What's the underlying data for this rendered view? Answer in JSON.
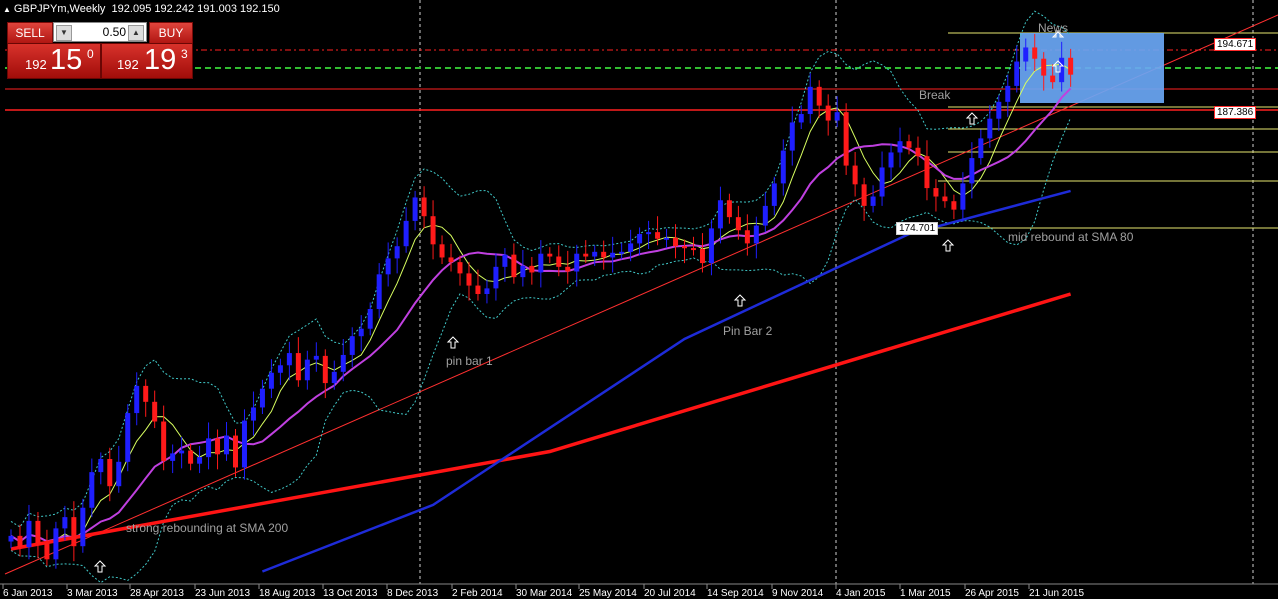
{
  "header": {
    "symbol_tf": "GBPJPYm,Weekly",
    "ohlc": "192.095 192.242 191.003 192.150"
  },
  "trade_panel": {
    "sell_label": "SELL",
    "buy_label": "BUY",
    "lot_value": "0.50",
    "sell_small": "192",
    "sell_big": "15",
    "sell_sup": "0",
    "buy_small": "192",
    "buy_big": "19",
    "buy_sup": "3"
  },
  "annotations": {
    "news": "News",
    "break": "Break",
    "pin_bar_1": "pin bar 1",
    "pin_bar_2": "Pin Bar 2",
    "strong_rebound": "strong rebounding at SMA 200",
    "mid_rebound": "mid rebound at SMA 80"
  },
  "price_labels": {
    "top": "194.671",
    "mid": "187.386",
    "low": "174.701"
  },
  "colors": {
    "background": "#000000",
    "bull_candle": "#1f1fff",
    "bear_candle": "#ff1a1a",
    "sma200": "#ff1414",
    "sma80": "#1e2bd8",
    "ma_purple": "#c040e0",
    "ma_yellow": "#d8ff60",
    "bollinger": "#40c8c8",
    "news_box": "#6aa7f5"
  },
  "chart_data": {
    "type": "candlestick",
    "title": "GBPJPYm,Weekly",
    "x_ticks": [
      "6 Jan 2013",
      "3 Mar 2013",
      "28 Apr 2013",
      "23 Jun 2013",
      "18 Aug 2013",
      "13 Oct 2013",
      "8 Dec 2013",
      "2 Feb 2014",
      "30 Mar 2014",
      "25 May 2014",
      "20 Jul 2014",
      "14 Sep 2014",
      "9 Nov 2014",
      "4 Jan 2015",
      "1 Mar 2015",
      "26 Apr 2015",
      "21 Jun 2015"
    ],
    "y_range_approx": [
      139,
      198
    ],
    "close_path": [
      [
        0,
        143.0
      ],
      [
        1,
        141.8
      ],
      [
        2,
        144.6
      ],
      [
        3,
        142.2
      ],
      [
        4,
        140.5
      ],
      [
        5,
        143.8
      ],
      [
        6,
        145.0
      ],
      [
        7,
        141.9
      ],
      [
        8,
        146.0
      ],
      [
        9,
        149.8
      ],
      [
        10,
        151.2
      ],
      [
        11,
        148.3
      ],
      [
        12,
        150.9
      ],
      [
        13,
        156.1
      ],
      [
        14,
        159.0
      ],
      [
        15,
        157.3
      ],
      [
        16,
        155.2
      ],
      [
        17,
        151.0
      ],
      [
        18,
        151.8
      ],
      [
        19,
        152.1
      ],
      [
        20,
        150.7
      ],
      [
        21,
        151.4
      ],
      [
        22,
        153.4
      ],
      [
        23,
        151.7
      ],
      [
        24,
        153.7
      ],
      [
        25,
        150.3
      ],
      [
        26,
        155.3
      ],
      [
        27,
        156.7
      ],
      [
        28,
        158.7
      ],
      [
        29,
        160.4
      ],
      [
        30,
        161.2
      ],
      [
        31,
        162.5
      ],
      [
        32,
        159.6
      ],
      [
        33,
        161.8
      ],
      [
        34,
        162.2
      ],
      [
        35,
        159.3
      ],
      [
        36,
        160.5
      ],
      [
        37,
        162.3
      ],
      [
        38,
        164.3
      ],
      [
        39,
        165.1
      ],
      [
        40,
        167.2
      ],
      [
        41,
        170.9
      ],
      [
        42,
        172.6
      ],
      [
        43,
        173.9
      ],
      [
        44,
        176.6
      ],
      [
        45,
        179.1
      ],
      [
        46,
        177.1
      ],
      [
        47,
        174.1
      ],
      [
        48,
        172.7
      ],
      [
        49,
        172.2
      ],
      [
        50,
        171.0
      ],
      [
        51,
        169.7
      ],
      [
        52,
        168.8
      ],
      [
        53,
        169.4
      ],
      [
        54,
        171.7
      ],
      [
        55,
        173.0
      ],
      [
        56,
        170.6
      ],
      [
        57,
        171.8
      ],
      [
        58,
        171.1
      ],
      [
        59,
        173.1
      ],
      [
        60,
        172.8
      ],
      [
        61,
        171.7
      ],
      [
        62,
        171.2
      ],
      [
        63,
        173.1
      ],
      [
        64,
        172.8
      ],
      [
        65,
        173.3
      ],
      [
        66,
        172.7
      ],
      [
        67,
        173.2
      ],
      [
        68,
        173.3
      ],
      [
        69,
        174.2
      ],
      [
        70,
        175.2
      ],
      [
        71,
        175.4
      ],
      [
        72,
        174.7
      ],
      [
        73,
        174.8
      ],
      [
        74,
        173.9
      ],
      [
        75,
        173.7
      ],
      [
        76,
        173.6
      ],
      [
        77,
        172.1
      ],
      [
        78,
        175.8
      ],
      [
        79,
        178.8
      ],
      [
        80,
        177.0
      ],
      [
        81,
        175.6
      ],
      [
        82,
        174.2
      ],
      [
        83,
        176.1
      ],
      [
        84,
        178.2
      ],
      [
        85,
        180.6
      ],
      [
        86,
        184.1
      ],
      [
        87,
        187.1
      ],
      [
        88,
        188.0
      ],
      [
        89,
        190.9
      ],
      [
        90,
        188.9
      ],
      [
        91,
        187.3
      ],
      [
        92,
        188.2
      ],
      [
        93,
        182.5
      ],
      [
        94,
        180.5
      ],
      [
        95,
        178.2
      ],
      [
        96,
        179.2
      ],
      [
        97,
        182.3
      ],
      [
        98,
        183.9
      ],
      [
        99,
        185.1
      ],
      [
        100,
        184.4
      ],
      [
        101,
        183.5
      ],
      [
        102,
        180.1
      ],
      [
        103,
        179.2
      ],
      [
        104,
        178.7
      ],
      [
        105,
        177.8
      ],
      [
        106,
        180.6
      ],
      [
        107,
        183.3
      ],
      [
        108,
        185.4
      ],
      [
        109,
        187.5
      ],
      [
        110,
        189.3
      ],
      [
        111,
        191.0
      ],
      [
        112,
        193.6
      ],
      [
        113,
        195.1
      ],
      [
        114,
        193.9
      ],
      [
        115,
        192.1
      ],
      [
        116,
        191.4
      ],
      [
        117,
        194.0
      ],
      [
        118,
        192.2
      ]
    ],
    "sma200_approx": [
      [
        0,
        141.6
      ],
      [
        118,
        168.8
      ]
    ],
    "sma80_approx": [
      [
        28,
        139.2
      ],
      [
        118,
        179.8
      ]
    ],
    "levels": {
      "top": 194.671,
      "mid": 187.386,
      "low": 174.701
    },
    "grid": false
  }
}
